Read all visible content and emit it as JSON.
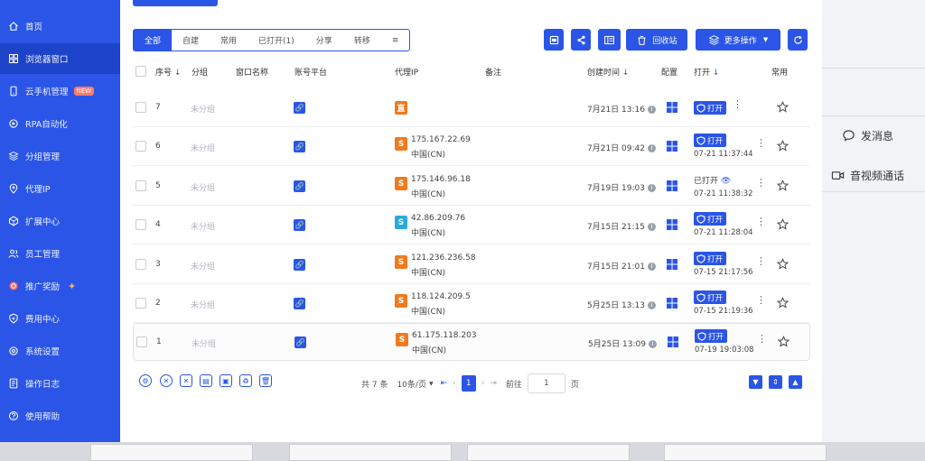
{
  "sidebar": {
    "items": [
      {
        "label": "首页",
        "icon": "home-icon"
      },
      {
        "label": "浏览器窗口",
        "icon": "grid-icon",
        "active": true
      },
      {
        "label": "云手机管理",
        "icon": "phone-icon",
        "badge": "NEW"
      },
      {
        "label": "RPA自动化",
        "icon": "rpa-icon"
      },
      {
        "label": "分组管理",
        "icon": "layers-icon"
      },
      {
        "label": "代理IP",
        "icon": "location-icon"
      },
      {
        "label": "扩展中心",
        "icon": "puzzle-icon"
      },
      {
        "label": "员工管理",
        "icon": "users-icon"
      },
      {
        "label": "推广奖励",
        "icon": "gift-icon"
      },
      {
        "label": "费用中心",
        "icon": "wallet-icon"
      },
      {
        "label": "系统设置",
        "icon": "gear-icon"
      },
      {
        "label": "操作日志",
        "icon": "log-icon"
      },
      {
        "label": "使用帮助",
        "icon": "help-icon"
      }
    ]
  },
  "filter_tabs": [
    "全部",
    "自建",
    "常用",
    "已打开(1)",
    "分享",
    "转移"
  ],
  "toolbar": {
    "recycle_label": "回收站",
    "more_label": "更多操作"
  },
  "table": {
    "headers": {
      "seq": "序号",
      "group": "分组",
      "name": "窗口名称",
      "platform": "账号平台",
      "proxy": "代理IP",
      "note": "备注",
      "created": "创建时间",
      "config": "配置",
      "open": "打开",
      "favorite": "常用"
    },
    "rows": [
      {
        "seq": "7",
        "group": "未分组",
        "proxy_badge": "直",
        "proxy_ip": "",
        "proxy_region": "",
        "created": "7月21日 13:16",
        "open_state": "打开",
        "open_time": ""
      },
      {
        "seq": "6",
        "group": "未分组",
        "proxy_badge": "S",
        "proxy_ip": "175.167.22.69",
        "proxy_region": "中国(CN)",
        "created": "7月21日 09:42",
        "open_state": "打开",
        "open_time": "07-21 11:37:44"
      },
      {
        "seq": "5",
        "group": "未分组",
        "proxy_badge": "S",
        "proxy_ip": "175.146.96.18",
        "proxy_region": "中国(CN)",
        "created": "7月19日 19:03",
        "open_state": "已打开",
        "open_time": "07-21 11:38:32"
      },
      {
        "seq": "4",
        "group": "未分组",
        "proxy_badge": "S",
        "proxy_ip": "42.86.209.76",
        "proxy_region": "中国(CN)",
        "created": "7月15日 21:15",
        "open_state": "打开",
        "open_time": "07-21 11:28:04"
      },
      {
        "seq": "3",
        "group": "未分组",
        "proxy_badge": "S",
        "proxy_ip": "121.236.236.58",
        "proxy_region": "中国(CN)",
        "created": "7月15日 21:01",
        "open_state": "打开",
        "open_time": "07-15 21:17:56"
      },
      {
        "seq": "2",
        "group": "未分组",
        "proxy_badge": "S",
        "proxy_ip": "118.124.209.5",
        "proxy_region": "中国(CN)",
        "created": "5月25日 13:13",
        "open_state": "打开",
        "open_time": "07-15 21:19:36"
      },
      {
        "seq": "1",
        "group": "未分组",
        "proxy_badge": "S",
        "proxy_ip": "61.175.118.203",
        "proxy_region": "中国(CN)",
        "created": "5月25日 13:09",
        "open_state": "打开",
        "open_time": "07-19 19:03:08"
      }
    ]
  },
  "pagination": {
    "total": "共 7 条",
    "page_size": "10条/页",
    "current_page": "1",
    "goto_label": "前往",
    "goto_value": "1",
    "page_suffix": "页"
  },
  "right_panel": {
    "message_label": "发消息",
    "video_label": "音视频通话"
  },
  "colors": {
    "brand": "#2b55e6",
    "proxy_orange": "#f07a1e",
    "proxy_cyan": "#29a9e0"
  }
}
